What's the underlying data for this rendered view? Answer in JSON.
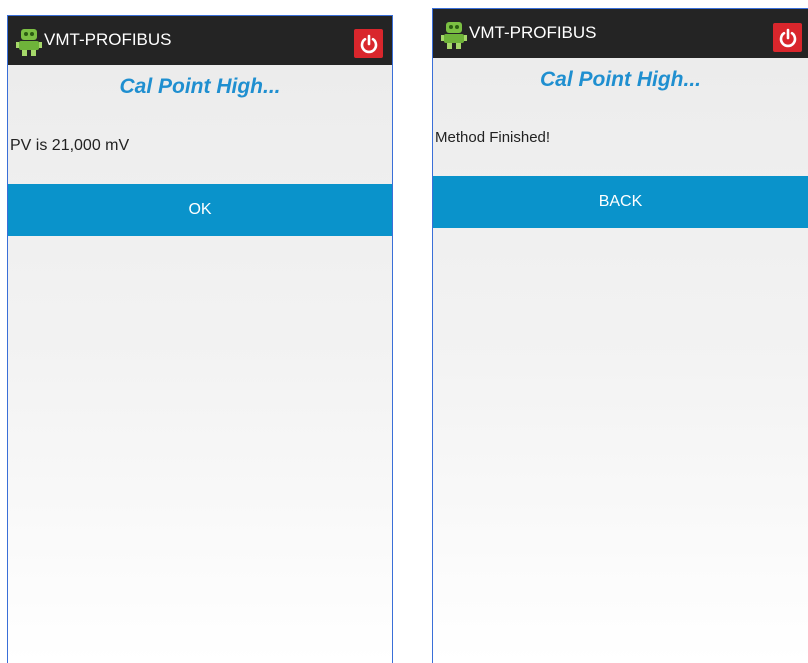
{
  "screens": [
    {
      "app_title": "VMT-PROFIBUS",
      "app_icon": "robot-icon",
      "power_icon": "power-icon",
      "heading": "Cal Point High...",
      "message": "PV is 21,000 mV",
      "button_label": "OK"
    },
    {
      "app_title": "VMT-PROFIBUS",
      "app_icon": "robot-icon",
      "power_icon": "power-icon",
      "heading": "Cal Point High...",
      "message": "Method Finished!",
      "button_label": "BACK"
    }
  ],
  "colors": {
    "titlebar": "#242424",
    "accent": "#1f8fd0",
    "button": "#0a93cb",
    "power": "#d9262c"
  }
}
